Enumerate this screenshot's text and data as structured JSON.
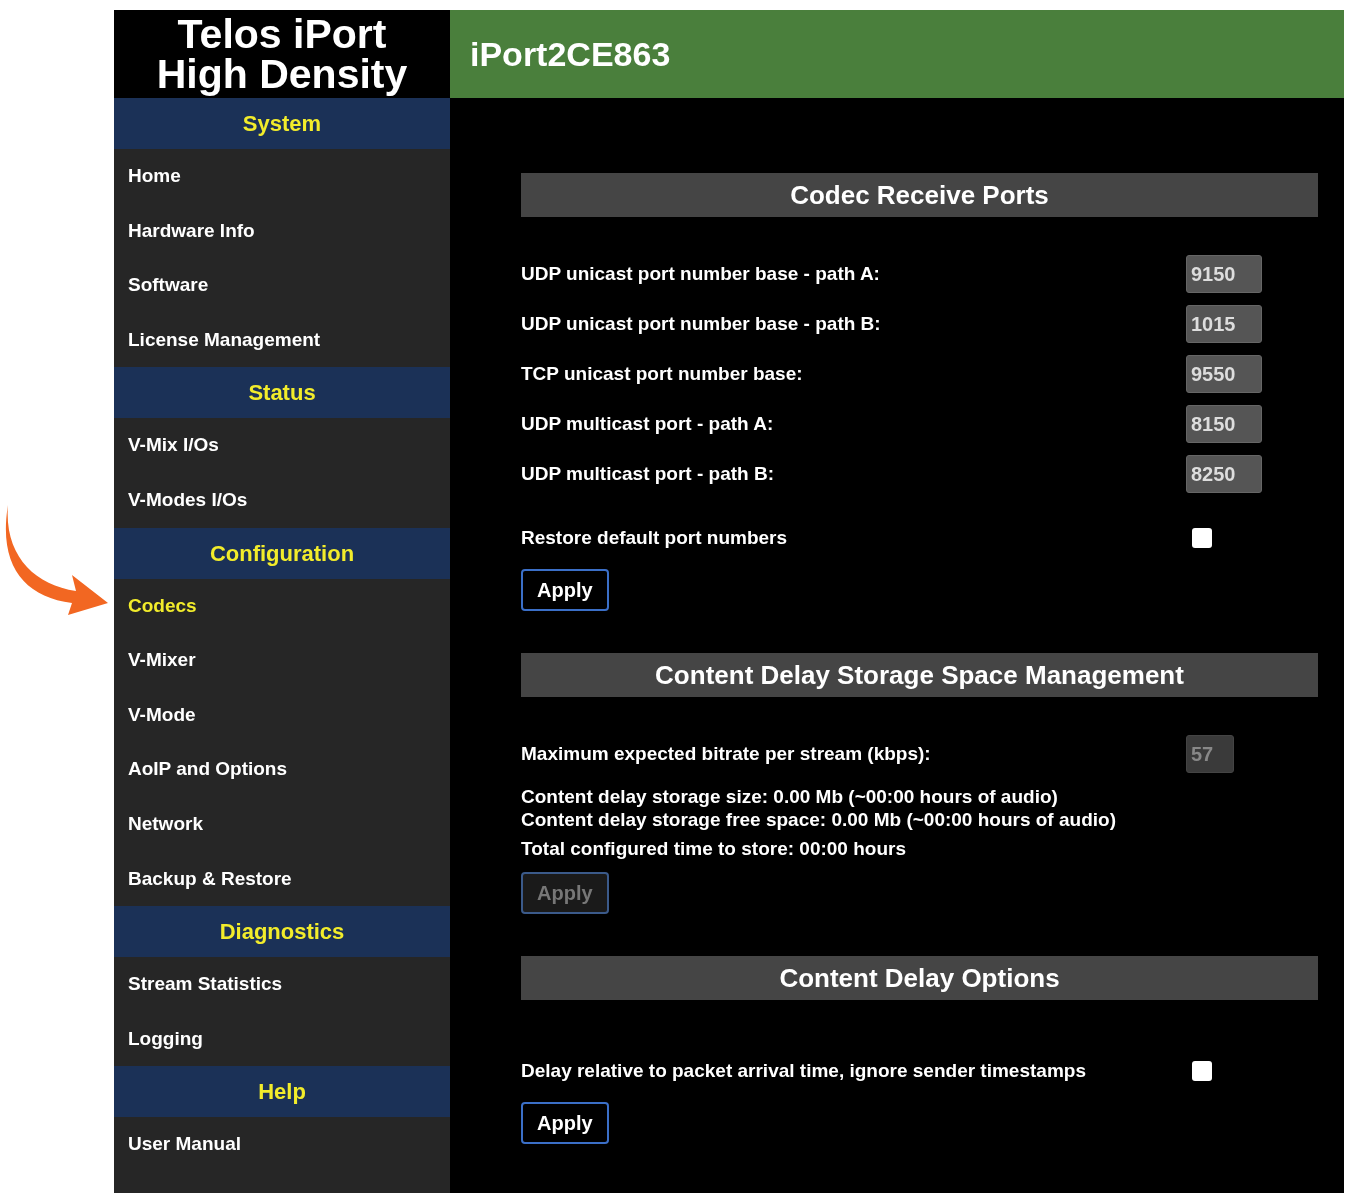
{
  "logo": {
    "lines": [
      "Telos iPort",
      "High Density"
    ]
  },
  "device_name": "iPort2CE863",
  "sidebar": [
    {
      "heading": "System",
      "items": [
        {
          "label": "Home",
          "selected": false
        },
        {
          "label": "Hardware Info",
          "selected": false
        },
        {
          "label": "Software",
          "selected": false
        },
        {
          "label": "License Management",
          "selected": false
        }
      ]
    },
    {
      "heading": "Status",
      "items": [
        {
          "label": "V-Mix I/Os",
          "selected": false
        },
        {
          "label": "V-Modes I/Os",
          "selected": false
        }
      ]
    },
    {
      "heading": "Configuration",
      "items": [
        {
          "label": "Codecs",
          "selected": true
        },
        {
          "label": "V-Mixer",
          "selected": false
        },
        {
          "label": "V-Mode",
          "selected": false
        },
        {
          "label": "AoIP and Options",
          "selected": false
        },
        {
          "label": "Network",
          "selected": false
        },
        {
          "label": "Backup & Restore",
          "selected": false
        }
      ]
    },
    {
      "heading": "Diagnostics",
      "items": [
        {
          "label": "Stream Statistics",
          "selected": false
        },
        {
          "label": "Logging",
          "selected": false
        }
      ]
    },
    {
      "heading": "Help",
      "items": [
        {
          "label": "User Manual",
          "selected": false
        }
      ]
    }
  ],
  "sections": [
    {
      "title": "Codec Receive Ports",
      "fields": [
        {
          "kind": "number",
          "label": "UDP unicast port number base - path A:",
          "value": "9150",
          "disabled": false
        },
        {
          "kind": "number",
          "label": "UDP unicast port number base - path B:",
          "value": "1015",
          "disabled": false
        },
        {
          "kind": "number",
          "label": "TCP unicast port number base:",
          "value": "9550",
          "disabled": false
        },
        {
          "kind": "number",
          "label": "UDP multicast port - path A:",
          "value": "8150",
          "disabled": false
        },
        {
          "kind": "number",
          "label": "UDP multicast port - path B:",
          "value": "8250",
          "disabled": false
        },
        {
          "kind": "checkbox",
          "label": "Restore default port numbers",
          "checked": false
        }
      ],
      "button": {
        "label": "Apply",
        "disabled": false
      }
    },
    {
      "title": "Content Delay Storage Space Management",
      "fields": [
        {
          "kind": "number",
          "label": "Maximum expected bitrate per stream (kbps):",
          "value": "57",
          "disabled": true
        },
        {
          "kind": "note",
          "lines": [
            "Content delay storage size: 0.00 Mb (~00:00 hours of audio)",
            "Content delay storage free space: 0.00 Mb (~00:00 hours of audio)"
          ]
        },
        {
          "kind": "note",
          "lines": [
            "Total configured time to store: 00:00 hours"
          ]
        }
      ],
      "button": {
        "label": "Apply",
        "disabled": true
      }
    },
    {
      "title": "Content Delay Options",
      "fields": [
        {
          "kind": "checkbox",
          "label": "Delay relative to packet arrival time, ignore sender timestamps",
          "checked": false
        }
      ],
      "button": {
        "label": "Apply",
        "disabled": false
      }
    }
  ]
}
